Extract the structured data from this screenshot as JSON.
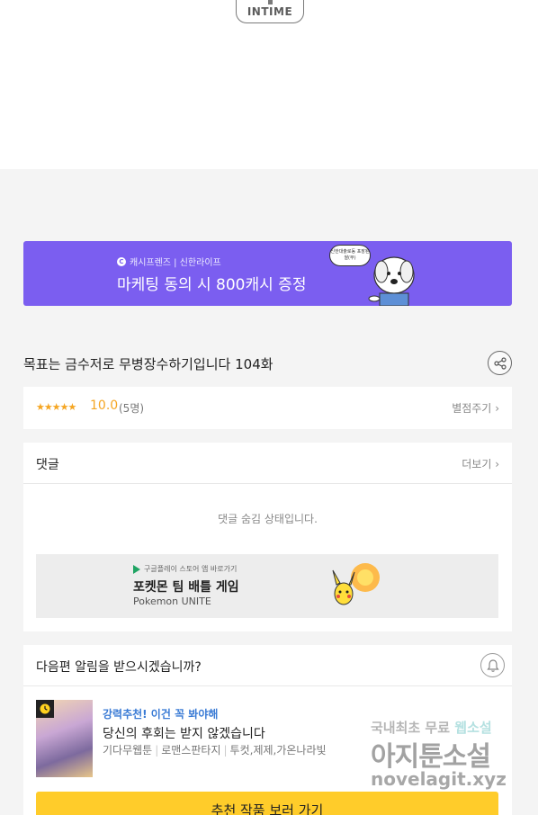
{
  "header": {
    "logo_text": "INTIME"
  },
  "banner": {
    "brand": "캐시프렌즈 | 신한라이프",
    "message": "마케팅 동의 시 800캐시 증정",
    "bubble_text": "신한대출로동 포장된 쌀(무)",
    "bg_color": "#7b5ef0"
  },
  "episode": {
    "title": "목표는 금수저로 무병장수하기입니다 104화"
  },
  "rating": {
    "stars": "★★★★★",
    "score": "10.0",
    "count": "(5명)",
    "rate_label": "별점주기",
    "color": "#f5a623"
  },
  "comments": {
    "label": "댓글",
    "more_label": "더보기",
    "hidden_message": "댓글 숨김 상태입니다."
  },
  "ad": {
    "store_text": "구글플레이 스토어 앱 바로가기",
    "game_title": "포켓몬 팀 배틀 게임",
    "game_subtitle": "Pokemon UNITE"
  },
  "notify": {
    "question": "다음편 알림을 받으시겠습니까?",
    "tag": "강력추천! 이건 꼭 봐야해",
    "title": "당신의 후회는 받지 않겠습니다",
    "meta": [
      "기다무웹툰",
      "로맨스판타지",
      "투컷,제제,가온나라빛"
    ],
    "cta_label": "추천 작품 보러 가기",
    "cta_color": "#ffcc2a"
  },
  "watermark": {
    "line1": "국내최초 무료",
    "line1_highlight": "웹소설",
    "line2": "아지툰소설",
    "line3": "novelagit.xyz"
  }
}
